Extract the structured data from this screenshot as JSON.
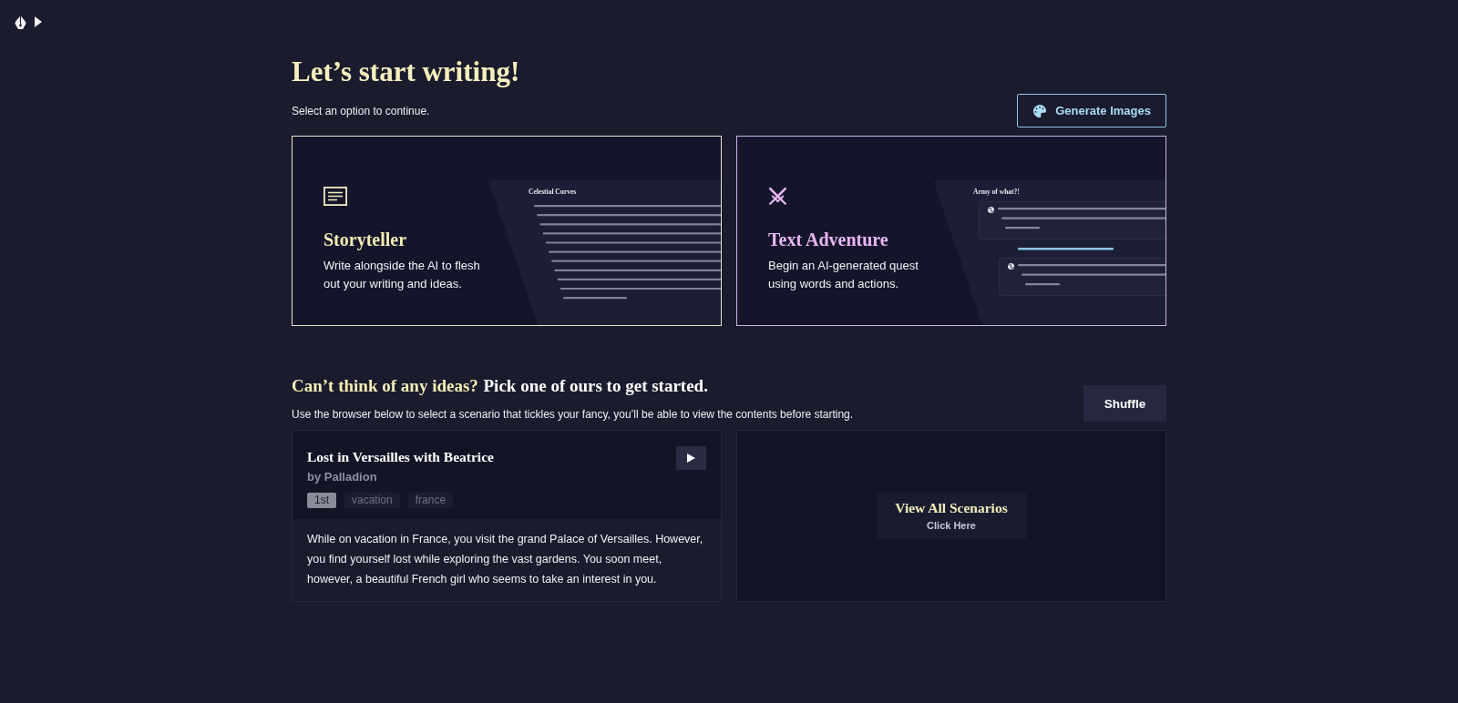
{
  "header": {
    "title": "Let’s start writing!",
    "subtitle": "Select an option to continue.",
    "action_button": "Generate Images"
  },
  "modes": [
    {
      "kind": "storyteller",
      "title": "Storyteller",
      "description": "Write alongside the AI to flesh out your writing and ideas.",
      "preview": {
        "title": "Celestial Curves"
      }
    },
    {
      "kind": "adventure",
      "title": "Text Adventure",
      "description": "Begin an AI-generated quest using words and actions.",
      "preview": {
        "title": "Army of what?!"
      }
    }
  ],
  "ideas": {
    "title": [
      {
        "kind": "highlight",
        "text": "Can’t think of any ideas?"
      },
      {
        "kind": "plain",
        "text": "Pick one of ours to get started."
      }
    ],
    "subtitle": "Use the browser below to select a scenario that tickles your fancy, you’ll be able to view the contents before starting.",
    "shuffle_button": "Shuffle",
    "scenario": {
      "title": "Lost in Versailles with Beatrice",
      "author": "by Palladion",
      "tags": [
        {
          "kind": "pov",
          "label": "1st"
        },
        {
          "kind": "tag",
          "label": "vacation"
        },
        {
          "kind": "tag",
          "label": "france"
        }
      ],
      "description": "While on vacation in France, you visit the grand Palace of Versailles. However, you find yourself lost while exploring the vast gardens. You soon meet, however, a beautiful French girl who seems to take an interest in you."
    },
    "browser": {
      "title": "View All Scenarios",
      "hint": "Click Here"
    }
  }
}
